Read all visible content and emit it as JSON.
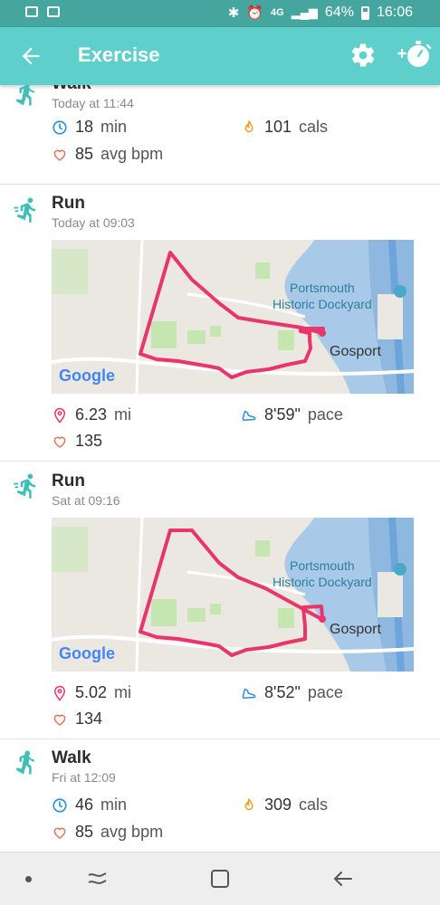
{
  "status_bar": {
    "battery": "64%",
    "time": "16:06",
    "network": "4G"
  },
  "app_bar": {
    "title": "Exercise"
  },
  "entries": [
    {
      "type": "Walk",
      "date": "Today at 11:44",
      "duration": "18",
      "duration_unit": "min",
      "calories": "101",
      "calories_unit": "cals",
      "bpm": "85",
      "bpm_unit": "avg bpm"
    },
    {
      "type": "Run",
      "date": "Today at 09:03",
      "distance": "6.23",
      "distance_unit": "mi",
      "pace": "8'59\"",
      "pace_unit": "pace",
      "bpm": "135",
      "map": {
        "label_dockyard_1": "Portsmouth",
        "label_dockyard_2": "Historic Dockyard",
        "label_town": "Gosport",
        "logo": "Google"
      }
    },
    {
      "type": "Run",
      "date": "Sat at 09:16",
      "distance": "5.02",
      "distance_unit": "mi",
      "pace": "8'52\"",
      "pace_unit": "pace",
      "bpm": "134",
      "map": {
        "label_dockyard_1": "Portsmouth",
        "label_dockyard_2": "Historic Dockyard",
        "label_town": "Gosport",
        "logo": "Google"
      }
    },
    {
      "type": "Walk",
      "date": "Fri at 12:09",
      "duration": "46",
      "duration_unit": "min",
      "calories": "309",
      "calories_unit": "cals",
      "bpm": "85",
      "bpm_unit": "avg bpm"
    }
  ],
  "colors": {
    "app_bar": "#5ecfcb",
    "status_bar": "#45a6a0",
    "activity_icon": "#3fbfb8",
    "route": "#e8356b",
    "flame": "#f0a020",
    "heart": "#e8735a"
  },
  "icons": [
    "back-arrow-icon",
    "gear-icon",
    "add-timer-icon",
    "walk-icon",
    "run-icon",
    "clock-icon",
    "flame-icon",
    "heart-icon",
    "location-pin-icon",
    "shoe-icon"
  ]
}
